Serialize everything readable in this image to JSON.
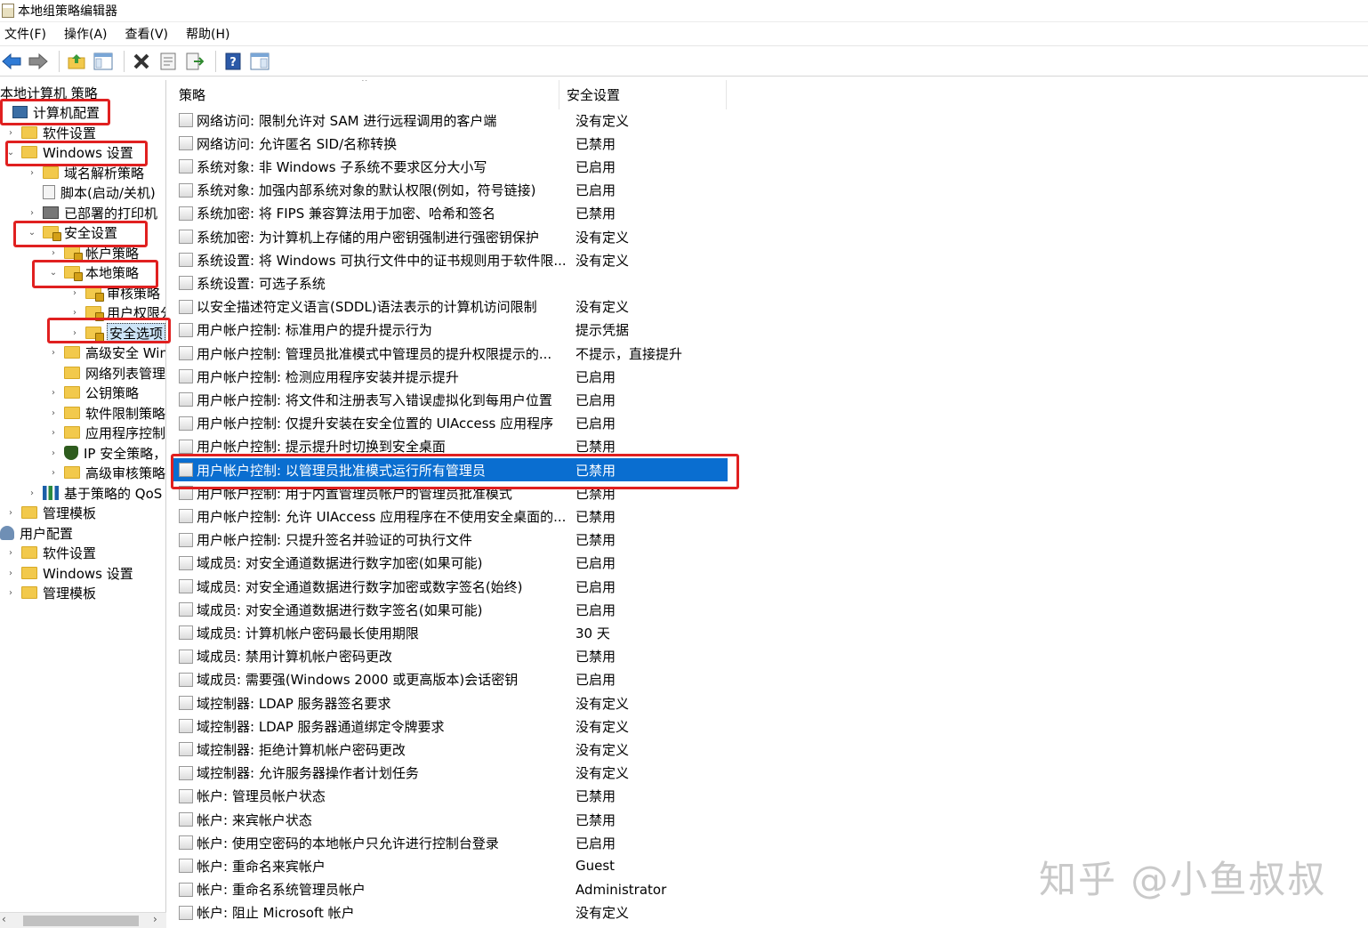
{
  "window": {
    "title": "本地组策略编辑器"
  },
  "menu": [
    "文件(F)",
    "操作(A)",
    "查看(V)",
    "帮助(H)"
  ],
  "toolbar": {
    "icons": [
      "back-arrow-icon",
      "forward-arrow-icon",
      "up-folder-icon",
      "show-hide-tree-icon",
      "delete-icon",
      "properties-icon",
      "export-list-icon",
      "help-icon",
      "mmc-view-icon"
    ]
  },
  "tree": {
    "root": "本地计算机 策略",
    "nodes": [
      {
        "label": "计算机配置",
        "icon": "computer-icon",
        "expanded": true
      },
      {
        "label": "软件设置",
        "icon": "folder-icon"
      },
      {
        "label": "Windows 设置",
        "icon": "folder-icon",
        "expanded": true
      },
      {
        "label": "域名解析策略",
        "icon": "folder-icon"
      },
      {
        "label": "脚本(启动/关机)",
        "icon": "script-icon"
      },
      {
        "label": "已部署的打印机",
        "icon": "printer-icon"
      },
      {
        "label": "安全设置",
        "icon": "security-folder-icon",
        "expanded": true
      },
      {
        "label": "帐户策略",
        "icon": "security-folder-icon"
      },
      {
        "label": "本地策略",
        "icon": "security-folder-icon",
        "expanded": true
      },
      {
        "label": "审核策略",
        "icon": "security-folder-icon"
      },
      {
        "label": "用户权限分配",
        "icon": "security-folder-icon"
      },
      {
        "label": "安全选项",
        "icon": "security-folder-icon",
        "selected": true
      },
      {
        "label": "高级安全 Windows Defender 防火墙",
        "icon": "folder-icon"
      },
      {
        "label": "网络列表管理器策略",
        "icon": "folder-icon"
      },
      {
        "label": "公钥策略",
        "icon": "folder-icon"
      },
      {
        "label": "软件限制策略",
        "icon": "folder-icon"
      },
      {
        "label": "应用程序控制策略",
        "icon": "folder-icon"
      },
      {
        "label": "IP 安全策略，在 本地计算机",
        "icon": "ip-security-icon"
      },
      {
        "label": "高级审核策略配置",
        "icon": "folder-icon"
      },
      {
        "label": "基于策略的 QoS",
        "icon": "qos-chart-icon"
      },
      {
        "label": "管理模板",
        "icon": "folder-icon"
      },
      {
        "label": "用户配置",
        "icon": "user-icon",
        "expanded": true
      },
      {
        "label": "软件设置",
        "icon": "folder-icon"
      },
      {
        "label": "Windows 设置",
        "icon": "folder-icon"
      },
      {
        "label": "管理模板",
        "icon": "folder-icon"
      }
    ]
  },
  "list": {
    "columns": [
      "策略",
      "安全设置"
    ],
    "rows": [
      {
        "policy": "网络访问: 限制允许对 SAM 进行远程调用的客户端",
        "setting": "没有定义"
      },
      {
        "policy": "网络访问: 允许匿名 SID/名称转换",
        "setting": "已禁用"
      },
      {
        "policy": "系统对象: 非 Windows 子系统不要求区分大小写",
        "setting": "已启用"
      },
      {
        "policy": "系统对象: 加强内部系统对象的默认权限(例如，符号链接)",
        "setting": "已启用"
      },
      {
        "policy": "系统加密: 将 FIPS 兼容算法用于加密、哈希和签名",
        "setting": "已禁用"
      },
      {
        "policy": "系统加密: 为计算机上存储的用户密钥强制进行强密钥保护",
        "setting": "没有定义"
      },
      {
        "policy": "系统设置: 将 Windows 可执行文件中的证书规则用于软件限...",
        "setting": "没有定义"
      },
      {
        "policy": "系统设置: 可选子系统",
        "setting": ""
      },
      {
        "policy": "以安全描述符定义语言(SDDL)语法表示的计算机访问限制",
        "setting": "没有定义"
      },
      {
        "policy": "用户帐户控制: 标准用户的提升提示行为",
        "setting": "提示凭据"
      },
      {
        "policy": "用户帐户控制: 管理员批准模式中管理员的提升权限提示的...",
        "setting": "不提示，直接提升"
      },
      {
        "policy": "用户帐户控制: 检测应用程序安装并提示提升",
        "setting": "已启用"
      },
      {
        "policy": "用户帐户控制: 将文件和注册表写入错误虚拟化到每用户位置",
        "setting": "已启用"
      },
      {
        "policy": "用户帐户控制: 仅提升安装在安全位置的 UIAccess 应用程序",
        "setting": "已启用"
      },
      {
        "policy": "用户帐户控制: 提示提升时切换到安全桌面",
        "setting": "已禁用"
      },
      {
        "policy": "用户帐户控制: 以管理员批准模式运行所有管理员",
        "setting": "已禁用",
        "selected": true
      },
      {
        "policy": "用户帐户控制: 用于内置管理员帐户的管理员批准模式",
        "setting": "已禁用"
      },
      {
        "policy": "用户帐户控制: 允许 UIAccess 应用程序在不使用安全桌面的...",
        "setting": "已禁用"
      },
      {
        "policy": "用户帐户控制: 只提升签名并验证的可执行文件",
        "setting": "已禁用"
      },
      {
        "policy": "域成员: 对安全通道数据进行数字加密(如果可能)",
        "setting": "已启用"
      },
      {
        "policy": "域成员: 对安全通道数据进行数字加密或数字签名(始终)",
        "setting": "已启用"
      },
      {
        "policy": "域成员: 对安全通道数据进行数字签名(如果可能)",
        "setting": "已启用"
      },
      {
        "policy": "域成员: 计算机帐户密码最长使用期限",
        "setting": "30 天"
      },
      {
        "policy": "域成员: 禁用计算机帐户密码更改",
        "setting": "已禁用"
      },
      {
        "policy": "域成员: 需要强(Windows 2000 或更高版本)会话密钥",
        "setting": "已启用"
      },
      {
        "policy": "域控制器: LDAP 服务器签名要求",
        "setting": "没有定义"
      },
      {
        "policy": "域控制器: LDAP 服务器通道绑定令牌要求",
        "setting": "没有定义"
      },
      {
        "policy": "域控制器: 拒绝计算机帐户密码更改",
        "setting": "没有定义"
      },
      {
        "policy": "域控制器: 允许服务器操作者计划任务",
        "setting": "没有定义"
      },
      {
        "policy": "帐户: 管理员帐户状态",
        "setting": "已禁用"
      },
      {
        "policy": "帐户: 来宾帐户状态",
        "setting": "已禁用"
      },
      {
        "policy": "帐户: 使用空密码的本地帐户只允许进行控制台登录",
        "setting": "已启用"
      },
      {
        "policy": "帐户: 重命名来宾帐户",
        "setting": "Guest"
      },
      {
        "policy": "帐户: 重命名系统管理员帐户",
        "setting": "Administrator"
      },
      {
        "policy": "帐户: 阻止 Microsoft 帐户",
        "setting": "没有定义"
      }
    ]
  },
  "watermark": "知乎 @小鱼叔叔",
  "colors": {
    "selection": "#0a6ed0",
    "annotation": "#e02020"
  }
}
